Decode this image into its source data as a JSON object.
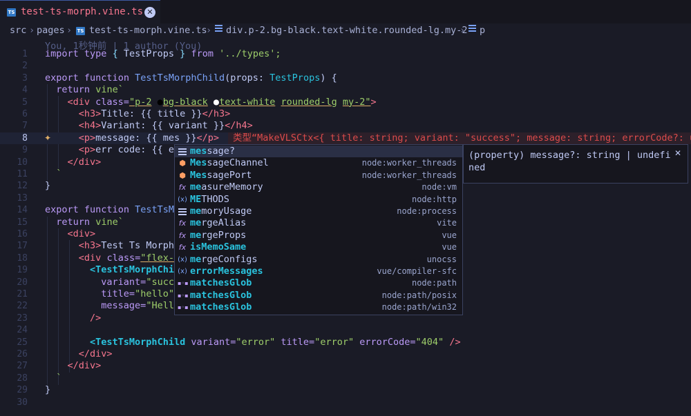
{
  "tab": {
    "icon": "TS",
    "title": "test-ts-morph.vine.ts 1",
    "close_icon": "✕"
  },
  "breadcrumb": {
    "src": "src",
    "pages": "pages",
    "file_icon": "TS",
    "file": "test-ts-morph.vine.ts",
    "div": "div.p-2.bg-black.text-white.rounded-lg.my-2",
    "p": "p"
  },
  "blame": "You, 1秒钟前 | 1 author (You)",
  "line_numbers": [
    "1",
    "2",
    "3",
    "4",
    "5",
    "6",
    "7",
    "8",
    "9",
    "10",
    "11",
    "12",
    "13",
    "14",
    "15",
    "16",
    "17",
    "18",
    "19",
    "20",
    "21",
    "22",
    "23",
    "24",
    "25",
    "26",
    "27",
    "28",
    "29",
    "30"
  ],
  "diagnostic": "类型“MakeVLSCtx<{ title: string; variant: \"success\"; message: string; errorCode?: unde",
  "lightbulb_icon": "✦",
  "suggestions": [
    {
      "icon": "property",
      "label_match": "mes",
      "label_rest": "sage?",
      "detail": ""
    },
    {
      "icon": "class",
      "label_match": "Mes",
      "label_rest": "sageChannel",
      "detail": "node:worker_threads"
    },
    {
      "icon": "class",
      "label_match": "Mes",
      "label_rest": "sagePort",
      "detail": "node:worker_threads"
    },
    {
      "icon": "function",
      "label_match": "me",
      "label_rest": "asureMemory",
      "detail": "node:vm"
    },
    {
      "icon": "variable",
      "label_match": "ME",
      "label_rest": "THODS",
      "detail": "node:http"
    },
    {
      "icon": "property",
      "label_match": "me",
      "label_rest": "moryUsage",
      "detail": "node:process"
    },
    {
      "icon": "function",
      "label_match": "me",
      "label_rest": "rgeAlias",
      "detail": "vite"
    },
    {
      "icon": "function",
      "label_match": "me",
      "label_rest": "rgeProps",
      "detail": "vue"
    },
    {
      "icon": "function",
      "label_match": "isMemoSame",
      "label_rest": "",
      "detail": "vue"
    },
    {
      "icon": "variable",
      "label_match": "me",
      "label_rest": "rgeConfigs",
      "detail": "unocss"
    },
    {
      "icon": "variable",
      "label_match": "errorMessages",
      "label_rest": "",
      "detail": "vue/compiler-sfc"
    },
    {
      "icon": "glob",
      "label_match": "matchesGlob",
      "label_rest": "",
      "detail": "node:path"
    },
    {
      "icon": "glob",
      "label_match": "matchesGlob",
      "label_rest": "",
      "detail": "node:path/posix"
    },
    {
      "icon": "glob",
      "label_match": "matchesGlob",
      "label_rest": "",
      "detail": "node:path/win32"
    }
  ],
  "detail_panel": {
    "text": "(property) message?: string | undefined",
    "close_icon": "✕"
  },
  "code": {
    "l1": [
      "import",
      "type",
      "{",
      "TestProps",
      "}",
      "from",
      "'../types';"
    ],
    "l3": [
      "export",
      "function",
      "TestTsMorphChild",
      "(props: ",
      "TestProps",
      ") {"
    ],
    "l4": [
      "return",
      "vine`"
    ],
    "l5": [
      "<div",
      "class=",
      "\"p-2",
      "bg-black",
      "text-white",
      "rounded-lg",
      "my-2\"",
      ">"
    ],
    "l6": [
      "<h3>",
      "Title: {{ title }}",
      "</h3>"
    ],
    "l7": [
      "<h4>",
      "Variant: {{ variant }}",
      "</h4>"
    ],
    "l8": [
      "<p>",
      "message: {{ mes }}",
      "</p>"
    ],
    "l9": [
      "<p>",
      "err code: {{ er"
    ],
    "l10": [
      "</div>"
    ],
    "l11": [
      "`"
    ],
    "l12": [
      "}"
    ],
    "l14": [
      "export",
      "function",
      "TestTsMo"
    ],
    "l15": [
      "return",
      "vine`"
    ],
    "l16": [
      "<div>"
    ],
    "l17": [
      "<h3>",
      "Test Ts Morph<"
    ],
    "l18": [
      "<div",
      "class=",
      "\"flex-r"
    ],
    "l19": [
      "<TestTsMorphChil"
    ],
    "l20": [
      "variant=",
      "\"succe"
    ],
    "l21": [
      "title=",
      "\"hello\""
    ],
    "l22": [
      "message=",
      "\"Hello"
    ],
    "l23": [
      "/>"
    ],
    "l25": [
      "<TestTsMorphChild",
      "variant=",
      "\"error\"",
      "title=",
      "\"error\"",
      "errorCode=",
      "\"404\"",
      "/>"
    ],
    "l26": [
      "</div>"
    ],
    "l27": [
      "</div>"
    ],
    "l28": [
      "`"
    ],
    "l29": [
      "}"
    ]
  }
}
